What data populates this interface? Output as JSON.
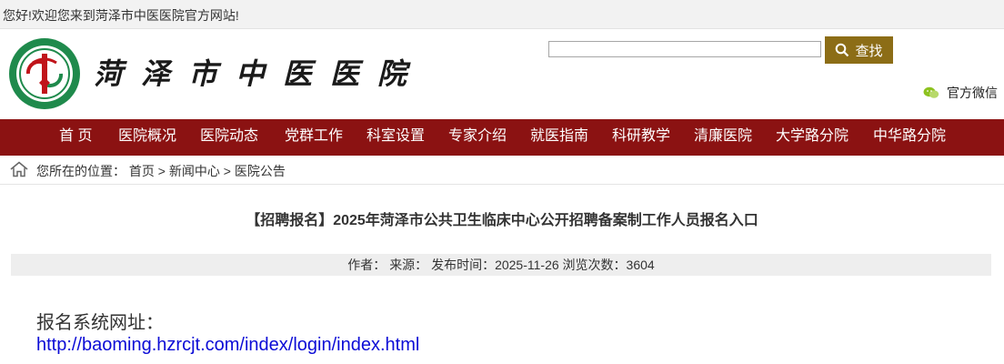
{
  "topbar": {
    "welcome": "您好!欢迎您来到菏泽市中医医院官方网站!"
  },
  "header": {
    "logo_text": "菏泽市中医医院",
    "search_placeholder": "",
    "search_button": "查找",
    "wechat_label": "官方微信"
  },
  "nav": {
    "items": [
      {
        "label": "首 页"
      },
      {
        "label": "医院概况"
      },
      {
        "label": "医院动态"
      },
      {
        "label": "党群工作"
      },
      {
        "label": "科室设置"
      },
      {
        "label": "专家介绍"
      },
      {
        "label": "就医指南"
      },
      {
        "label": "科研教学"
      },
      {
        "label": "清廉医院"
      },
      {
        "label": "大学路分院"
      },
      {
        "label": "中华路分院"
      }
    ]
  },
  "breadcrumb": {
    "prefix": "您所在的位置：",
    "items": [
      "首页",
      "新闻中心",
      "医院公告"
    ],
    "separator": ">"
  },
  "article": {
    "title": "【招聘报名】2025年菏泽市公共卫生临床中心公开招聘备案制工作人员报名入口",
    "author_label": "作者：",
    "source_label": "来源：",
    "date_label": "发布时间：",
    "date": "2025-11-26",
    "views_label": "浏览次数：",
    "views": "3604",
    "line1": "报名系统网址：",
    "link": "http://baoming.hzrcjt.com/index/login/index.html"
  },
  "colors": {
    "nav_bg": "#8b1212",
    "search_btn": "#8c6d16",
    "link": "#0b0bd6"
  }
}
